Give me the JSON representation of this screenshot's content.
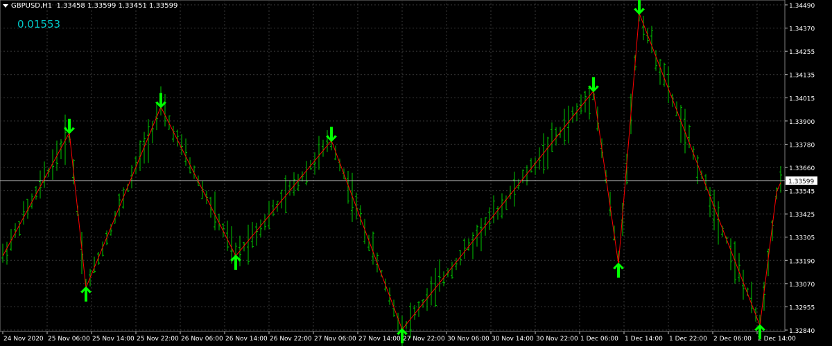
{
  "header": {
    "symbol": "GBPUSD,H1",
    "ohlc": "1.33458 1.33599 1.33451 1.33599"
  },
  "indicator_value": "0.01553",
  "colors": {
    "background": "#000000",
    "grid": "#3a3a3a",
    "bars": "#00c800",
    "zigzag": "#ff0000",
    "arrows": "#00ff00",
    "text": "#ffffff",
    "indicator": "#00c8c8",
    "price_line": "#c0c0c0"
  },
  "chart_data": {
    "type": "ohlc-bar",
    "symbol": "GBPUSD",
    "timeframe": "H1",
    "ylim": [
      1.3284,
      1.3449
    ],
    "y_ticks": [
      "1.34490",
      "1.34370",
      "1.34255",
      "1.34135",
      "1.34015",
      "1.33900",
      "1.33780",
      "1.33660",
      "1.33545",
      "1.33425",
      "1.33305",
      "1.33190",
      "1.33070",
      "1.32955",
      "1.32840"
    ],
    "x_tick_labels": [
      "24 Nov 2020",
      "25 Nov 06:00",
      "25 Nov 14:00",
      "25 Nov 22:00",
      "26 Nov 06:00",
      "26 Nov 14:00",
      "26 Nov 22:00",
      "27 Nov 06:00",
      "27 Nov 14:00",
      "27 Nov 22:00",
      "30 Nov 06:00",
      "30 Nov 14:00",
      "30 Nov 22:00",
      "1 Dec 06:00",
      "1 Dec 14:00",
      "1 Dec 22:00",
      "2 Dec 06:00",
      "2 Dec 14:00"
    ],
    "current_price": "1.33599",
    "grid": true,
    "zigzag": [
      {
        "bar": 0,
        "price": 1.3322
      },
      {
        "bar": 16,
        "price": 1.3384
      },
      {
        "bar": 20,
        "price": 1.3306
      },
      {
        "bar": 38,
        "price": 1.3397
      },
      {
        "bar": 56,
        "price": 1.3322
      },
      {
        "bar": 79,
        "price": 1.338
      },
      {
        "bar": 96,
        "price": 1.3285
      },
      {
        "bar": 142,
        "price": 1.3405
      },
      {
        "bar": 148,
        "price": 1.3318
      },
      {
        "bar": 153,
        "price": 1.3444
      },
      {
        "bar": 182,
        "price": 1.3287
      },
      {
        "bar": 186,
        "price": 1.3354
      },
      {
        "bar": 187,
        "price": 1.3359
      }
    ],
    "arrows": [
      {
        "bar": 16,
        "price": 1.3384,
        "direction": "down"
      },
      {
        "bar": 20,
        "price": 1.3306,
        "direction": "up"
      },
      {
        "bar": 38,
        "price": 1.3397,
        "direction": "down"
      },
      {
        "bar": 56,
        "price": 1.3322,
        "direction": "up"
      },
      {
        "bar": 79,
        "price": 1.338,
        "direction": "down"
      },
      {
        "bar": 96,
        "price": 1.3285,
        "direction": "up"
      },
      {
        "bar": 142,
        "price": 1.3405,
        "direction": "down"
      },
      {
        "bar": 148,
        "price": 1.3318,
        "direction": "up"
      },
      {
        "bar": 153,
        "price": 1.3444,
        "direction": "down"
      },
      {
        "bar": 182,
        "price": 1.3287,
        "direction": "up"
      }
    ]
  }
}
